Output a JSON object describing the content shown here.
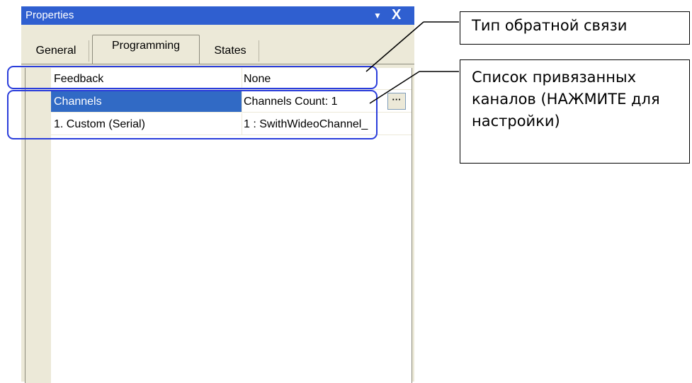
{
  "window": {
    "title": "Properties",
    "pin_glyph": "▼",
    "close_glyph": "X"
  },
  "tabs": [
    {
      "label": "General",
      "active": false
    },
    {
      "label": "Programming",
      "active": true
    },
    {
      "label": "States",
      "active": false
    }
  ],
  "properties": [
    {
      "name": "Feedback",
      "value": "None",
      "selected": false
    },
    {
      "name": "Channels",
      "value": "Channels Count: 1",
      "selected": true,
      "has_button": true,
      "button_label": "···"
    },
    {
      "name": "1. Custom (Serial)",
      "value": "1 : SwithWideoChannel_",
      "selected": false
    }
  ],
  "callouts": {
    "feedback_type": "Тип обратной связи",
    "channels_list": "Список привязанных каналов (НАЖМИТЕ для настройки)"
  },
  "colors": {
    "titlebar": "#2f5fd0",
    "selection": "#316ac5",
    "highlight_outline": "#2a3ddb",
    "panel_bg": "#ece9d8"
  }
}
